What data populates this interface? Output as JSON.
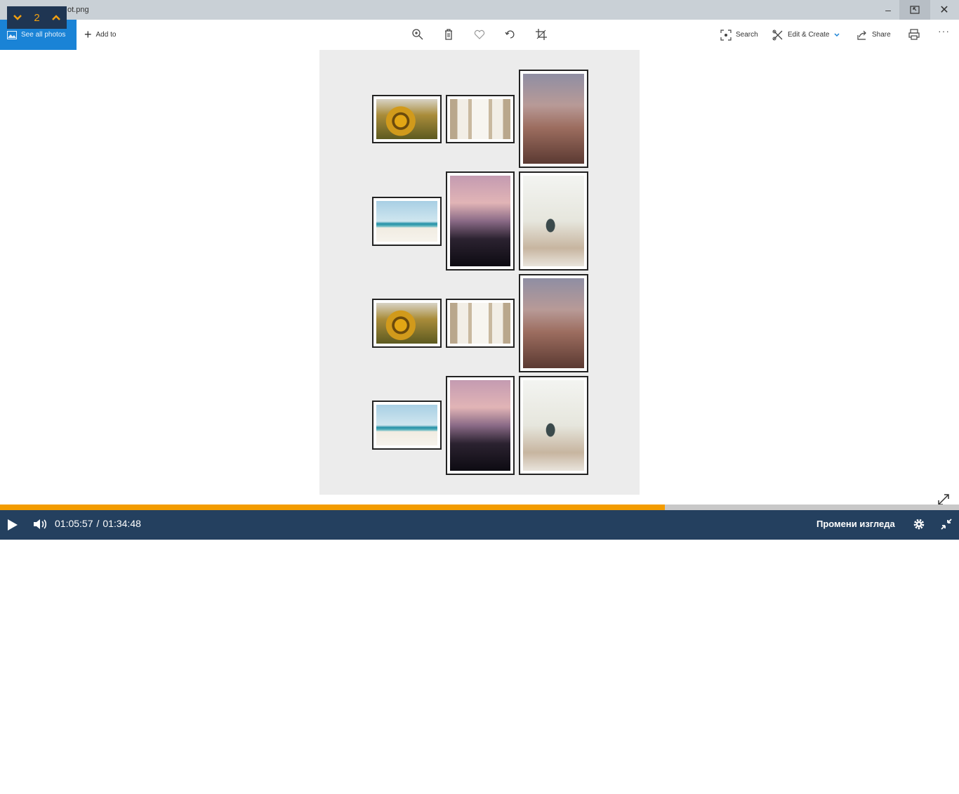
{
  "window": {
    "title": "ot.png",
    "minimize": "–",
    "close": "✕"
  },
  "subtitle_nav": {
    "prev": "⌄",
    "count": "2",
    "next": "⌃"
  },
  "toolbar": {
    "see_all_photos": "See all photos",
    "add_to": "Add to",
    "search": "Search",
    "edit_create": "Edit & Create",
    "share": "Share",
    "more": "···",
    "icons": [
      "zoom-in-icon",
      "delete-icon",
      "favorite-icon",
      "rotate-icon",
      "crop-icon",
      "print-icon"
    ]
  },
  "image": {
    "thumbnails": [
      "sunflower",
      "hallway-figure",
      "skateboarder",
      "palm-tree",
      "surfer-sunset",
      "hand-cup",
      "sunflower",
      "hallway-figure",
      "skateboarder",
      "palm-tree",
      "surfer-sunset",
      "hand-cup"
    ]
  },
  "player": {
    "elapsed": "01:05:57",
    "separator": "/",
    "duration": "01:34:48",
    "progress": 0.693,
    "change_view": "Промени изгледа",
    "colors": {
      "bar": "#24405f",
      "progress": "#f39c00"
    }
  }
}
